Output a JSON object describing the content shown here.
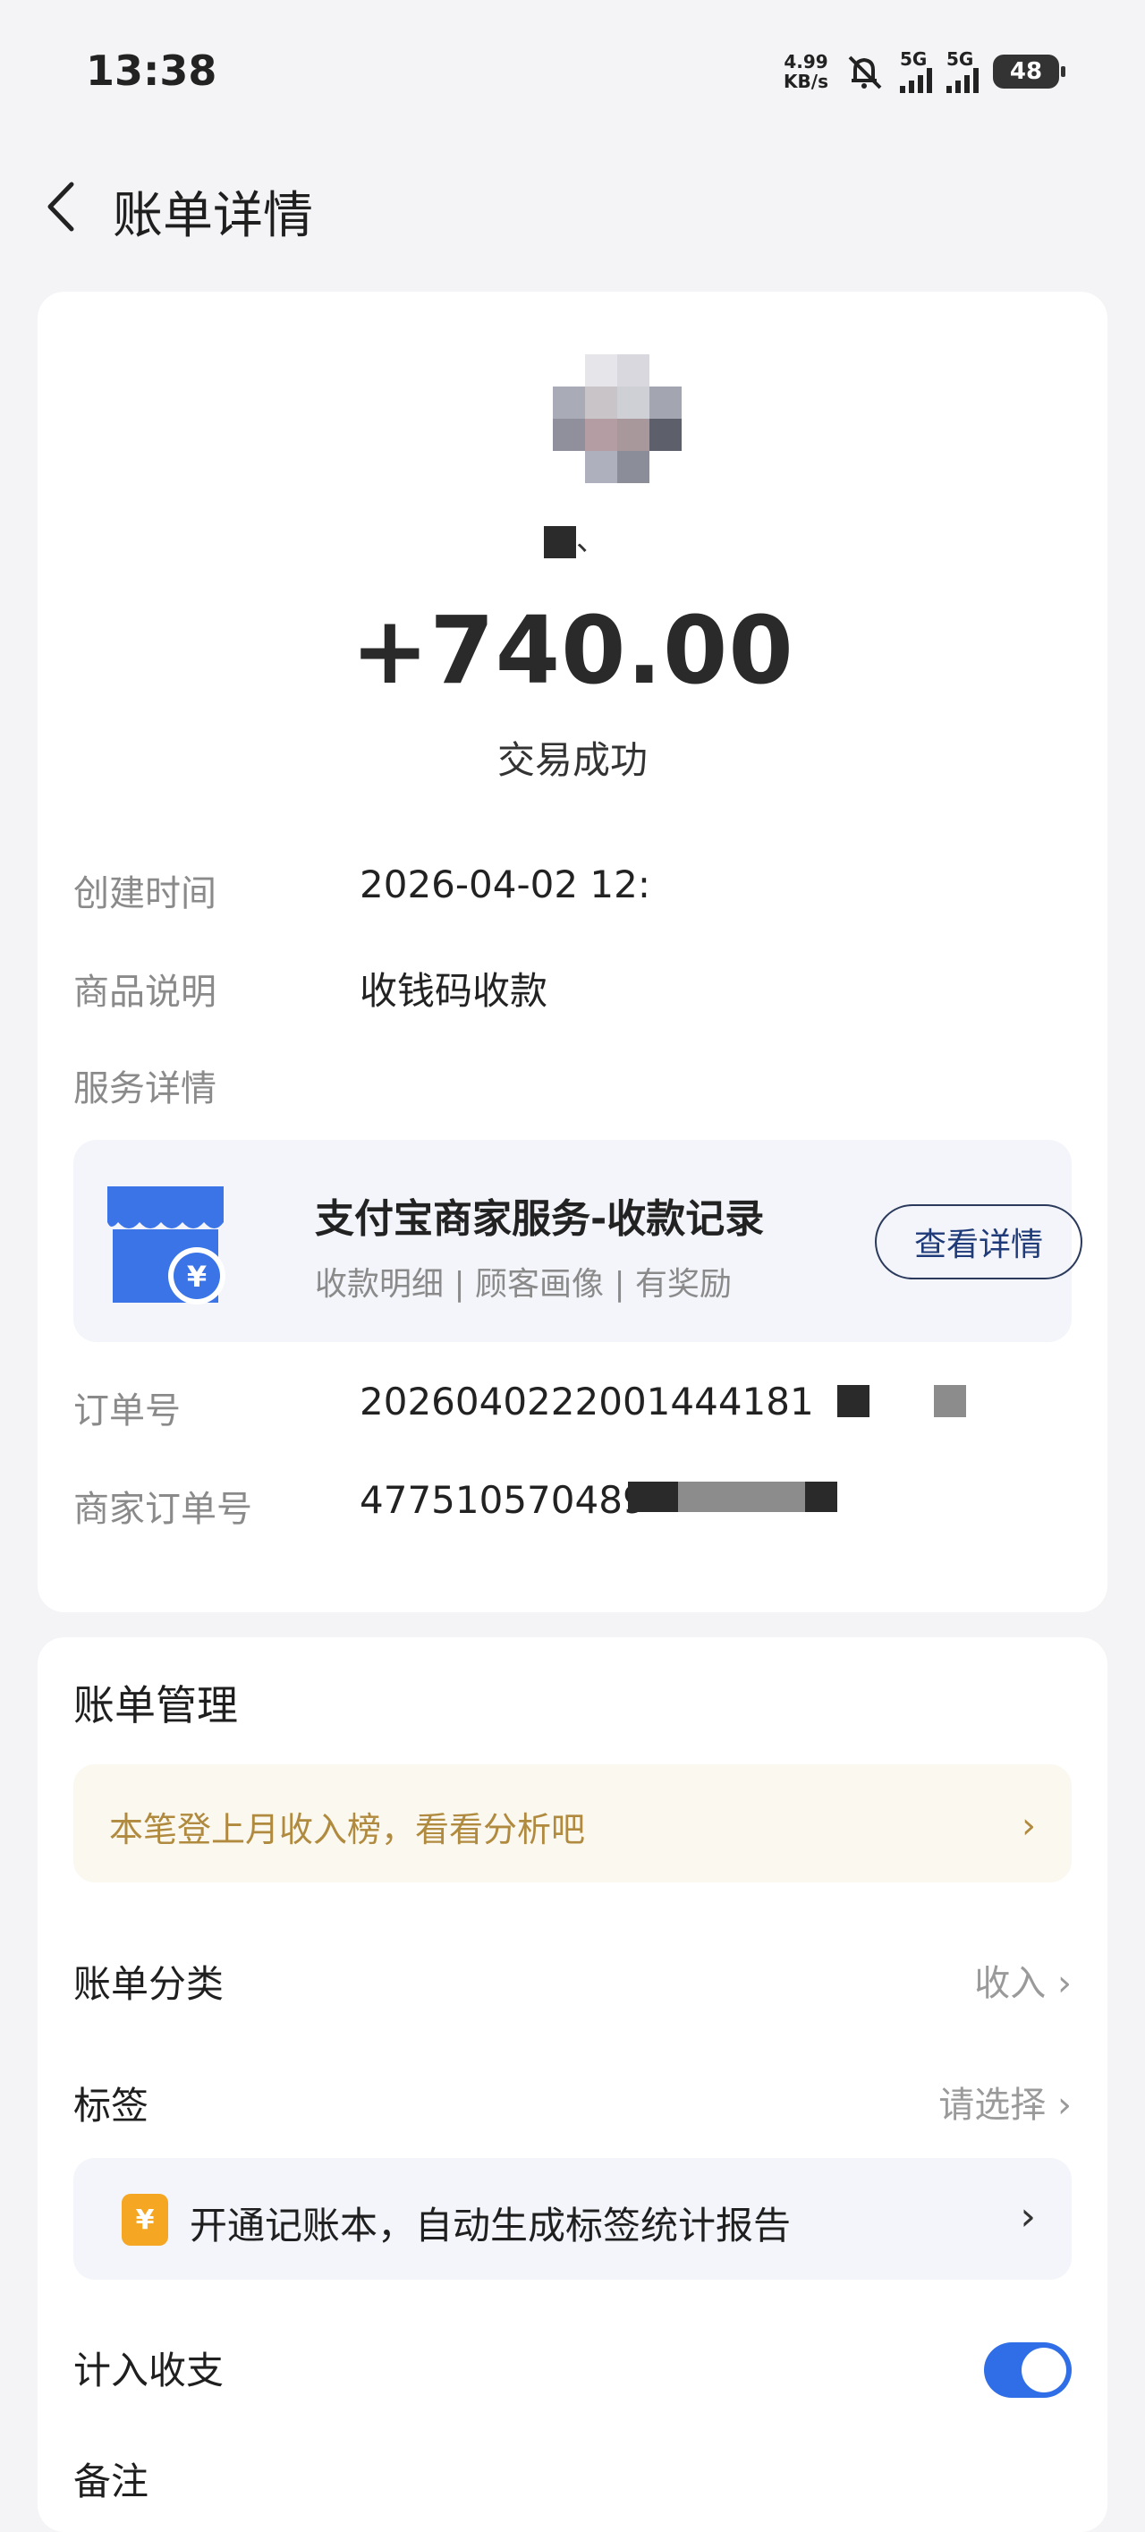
{
  "status_bar": {
    "time": "13:38",
    "net_speed_value": "4.99",
    "net_speed_unit": "KB/s",
    "sim1_label": "5G",
    "sim2_label": "5G",
    "battery": "48"
  },
  "nav": {
    "title": "账单详情"
  },
  "bill": {
    "amount": "+740.00",
    "status": "交易成功",
    "created_label": "创建时间",
    "created_value": "2026-04-02 12:",
    "desc_label": "商品说明",
    "desc_value": "收钱码收款",
    "service_label": "服务详情",
    "service": {
      "title": "支付宝商家服务-收款记录",
      "subtitle": "收款明细 | 顾客画像 | 有奖励",
      "button": "查看详情"
    },
    "order_label": "订单号",
    "order_value": "2026040222001444181",
    "merchant_order_label": "商家订单号",
    "merchant_order_value": "477510570489"
  },
  "management": {
    "title": "账单管理",
    "hint": "本笔登上月收入榜，看看分析吧",
    "category_label": "账单分类",
    "category_value": "收入",
    "tag_label": "标签",
    "tag_value": "请选择",
    "promo_text": "开通记账本，自动生成标签统计报告",
    "count_label": "计入收支",
    "count_enabled": true,
    "note_label": "备注"
  },
  "colors": {
    "accent": "#2f6ee6",
    "hint_text": "#b08a3e",
    "service_icon": "#3b74e6"
  }
}
